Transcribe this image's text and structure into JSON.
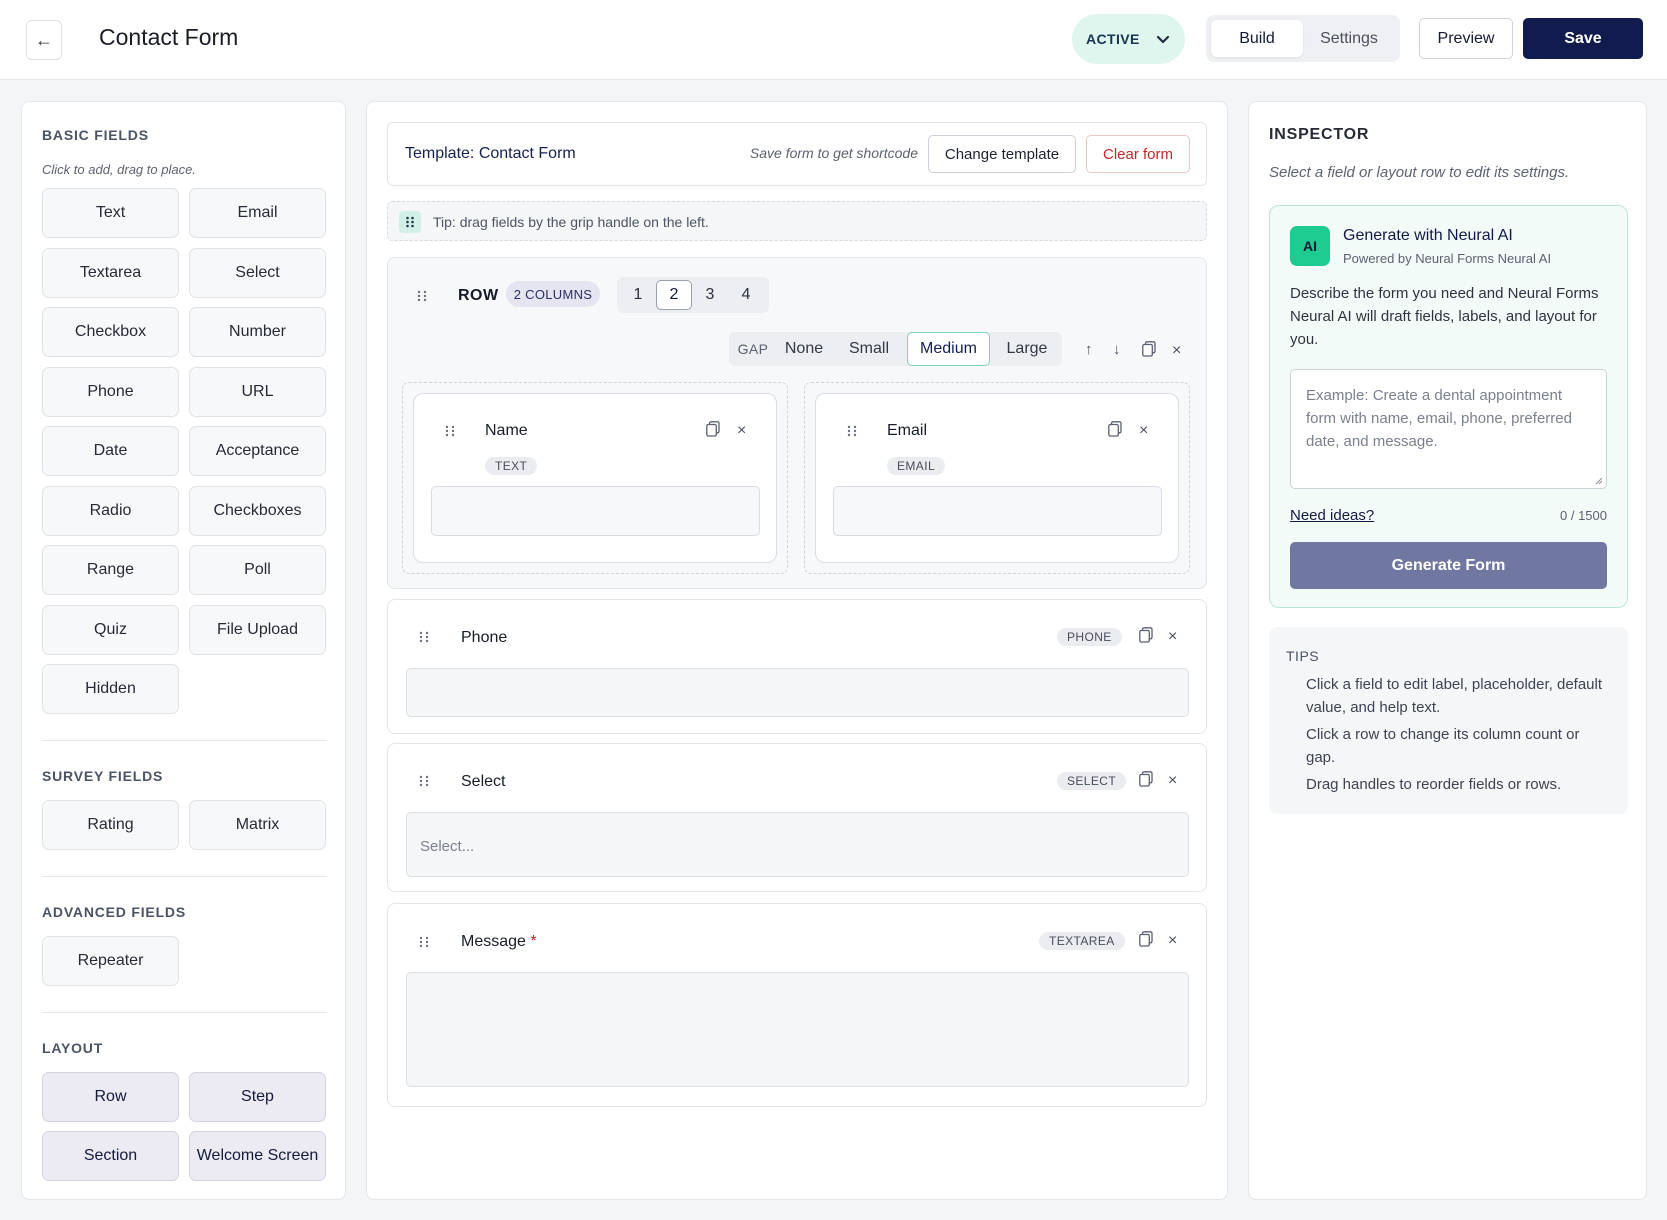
{
  "header": {
    "back_icon": "arrow-left-icon",
    "title": "Contact Form",
    "status": "ACTIVE",
    "tabs": [
      {
        "label": "Build",
        "active": true
      },
      {
        "label": "Settings",
        "active": false
      }
    ],
    "preview_label": "Preview",
    "save_label": "Save"
  },
  "left": {
    "basic_title": "BASIC FIELDS",
    "basic_hint": "Click to add, drag to place.",
    "basic_fields": [
      "Text",
      "Email",
      "Textarea",
      "Select",
      "Checkbox",
      "Number",
      "Phone",
      "URL",
      "Date",
      "Acceptance",
      "Radio",
      "Checkboxes",
      "Range",
      "Poll",
      "Quiz",
      "File Upload",
      "Hidden"
    ],
    "survey_title": "SURVEY FIELDS",
    "survey_fields": [
      "Rating",
      "Matrix"
    ],
    "advanced_title": "ADVANCED FIELDS",
    "advanced_fields": [
      "Repeater"
    ],
    "layout_title": "LAYOUT",
    "layout_fields": [
      "Row",
      "Step",
      "Section",
      "Welcome Screen"
    ]
  },
  "center": {
    "template_label": "Template: Contact Form",
    "template_hint": "Save form to get shortcode",
    "change_template": "Change template",
    "clear_form": "Clear form",
    "tip": "Tip: drag fields by the grip handle on the left.",
    "row": {
      "label": "ROW",
      "columns_badge": "2 COLUMNS",
      "column_options": [
        "1",
        "2",
        "3",
        "4"
      ],
      "active_columns": "2",
      "gap_label": "GAP",
      "gap_options": [
        "None",
        "Small",
        "Medium",
        "Large"
      ],
      "active_gap": "Medium",
      "tool_up": "↑",
      "tool_down": "↓",
      "tool_close": "×",
      "fields": [
        {
          "label": "Name",
          "type": "TEXT"
        },
        {
          "label": "Email",
          "type": "EMAIL"
        }
      ]
    },
    "phone_field": {
      "label": "Phone",
      "type": "PHONE"
    },
    "select_field": {
      "label": "Select",
      "type": "SELECT",
      "placeholder": "Select..."
    },
    "message_field": {
      "label": "Message",
      "required_mark": "*",
      "type": "TEXTAREA"
    },
    "close_glyph": "×"
  },
  "inspector": {
    "title": "INSPECTOR",
    "hint": "Select a field or layout row to edit its settings.",
    "ai": {
      "badge": "AI",
      "title": "Generate with Neural AI",
      "subtitle": "Powered by Neural Forms Neural AI",
      "description": "Describe the form you need and Neural Forms Neural AI will draft fields, labels, and layout for you.",
      "placeholder": "Example: Create a dental appointment form with name, email, phone, preferred date, and message.",
      "ideas_link": "Need ideas?",
      "counter": "0 / 1500",
      "generate_label": "Generate Form"
    },
    "tips_title": "TIPS",
    "tips": [
      "Click a field to edit label, placeholder, default value, and help text.",
      "Click a row to change its column count or gap.",
      "Drag handles to reorder fields or rows."
    ]
  },
  "colors": {
    "primary": "#111b4d",
    "accent": "#1ecc91",
    "danger": "#c52626",
    "status_bg": "#dff6ee"
  }
}
